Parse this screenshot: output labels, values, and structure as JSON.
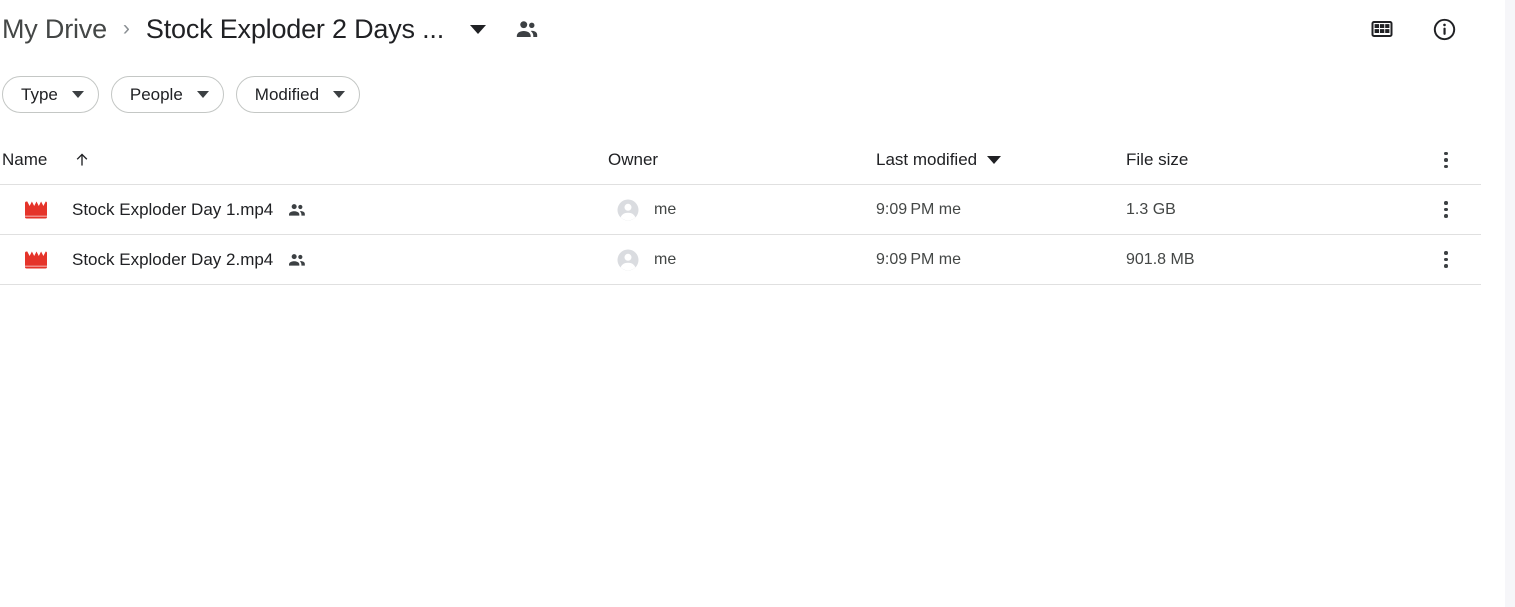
{
  "app": {
    "name": "Google Drive",
    "background_color": "#ffffff",
    "accent_color": "#202124",
    "video_icon_color": "#e5342a",
    "divider_color": "#e0e0e0"
  },
  "breadcrumb": {
    "root_label": "My Drive",
    "separator": "›",
    "current_label": "Stock Exploder 2 Days ...",
    "caret_icon": "chevron-down-icon",
    "shared_icon": "people-shared-icon"
  },
  "header_actions": [
    {
      "name": "grid-view-button",
      "icon": "grid-view-icon"
    },
    {
      "name": "details-info-button",
      "icon": "info-circle-icon"
    }
  ],
  "filters": [
    {
      "label": "Type",
      "caret_icon": "chevron-down-icon"
    },
    {
      "label": "People",
      "caret_icon": "chevron-down-icon"
    },
    {
      "label": "Modified",
      "caret_icon": "chevron-down-icon"
    }
  ],
  "table": {
    "columns": [
      {
        "key": "name",
        "label": "Name",
        "sort_icon": "arrow-up-icon",
        "sorted": true
      },
      {
        "key": "owner",
        "label": "Owner"
      },
      {
        "key": "modified",
        "label": "Last modified",
        "caret_icon": "chevron-down-icon"
      },
      {
        "key": "size",
        "label": "File size"
      }
    ],
    "header_menu_icon": "more-vertical-icon",
    "rows": [
      {
        "file_icon": "video-clapperboard-icon",
        "name": "Stock Exploder Day 1.mp4",
        "shared_icon": "people-shared-icon",
        "owner_avatar": "account-circle-icon",
        "owner": "me",
        "modified": "9:09 PM  me",
        "size": "1.3 GB",
        "menu_icon": "more-vertical-icon"
      },
      {
        "file_icon": "video-clapperboard-icon",
        "name": "Stock Exploder Day 2.mp4",
        "shared_icon": "people-shared-icon",
        "owner_avatar": "account-circle-icon",
        "owner": "me",
        "modified": "9:09 PM  me",
        "size": "901.8 MB",
        "menu_icon": "more-vertical-icon"
      }
    ]
  }
}
